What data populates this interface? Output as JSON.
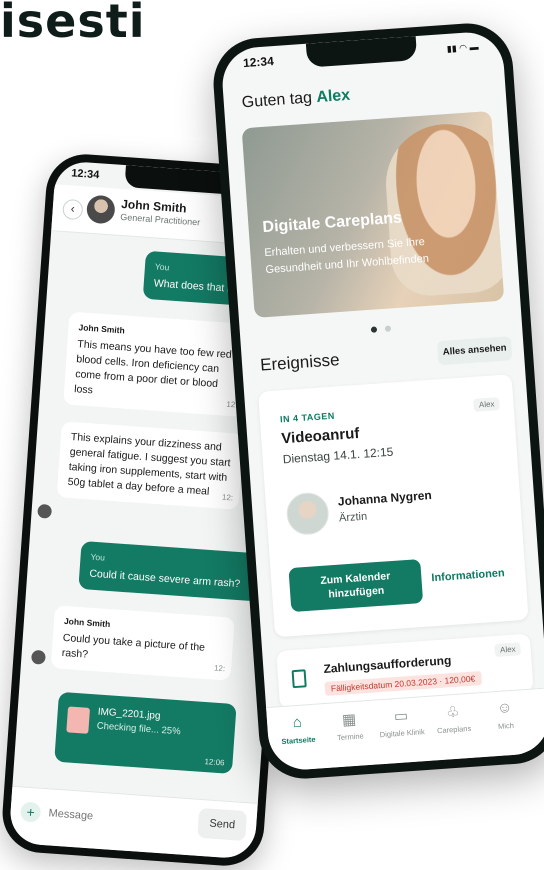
{
  "headline": "isesti",
  "chat_phone": {
    "status_time": "12:34",
    "contact": {
      "name": "John Smith",
      "role": "General Practitioner"
    },
    "messages": [
      {
        "from": "me",
        "sender": "You",
        "text": "What does that mean?"
      },
      {
        "from": "them",
        "sender": "John Smith",
        "text": "This means you have too few red blood cells. Iron deficiency can come from a poor diet or blood loss",
        "time": "12:"
      },
      {
        "from": "them",
        "text": "This explains your dizziness and general fatigue. I suggest you start taking iron supplements, start with 50g tablet a day before a meal",
        "time": "12:"
      },
      {
        "from": "me",
        "sender": "You",
        "text": "Could it cause severe arm rash?"
      },
      {
        "from": "them",
        "sender": "John Smith",
        "text": "Could you take a picture of the rash?",
        "time": "12:"
      }
    ],
    "file": {
      "name": "IMG_2201.jpg",
      "status": "Checking file... 25%",
      "time": "12:06"
    },
    "compose": {
      "placeholder": "Message",
      "send_label": "Send"
    }
  },
  "app_phone": {
    "status_time": "12:34",
    "greeting": "Guten tag",
    "user_name": "Alex",
    "banner": {
      "title": "Digitale Careplans",
      "text": "Erhalten und verbessern Sie Ihre Gesundheit und Ihr Wohlbefinden"
    },
    "events_title": "Ereignisse",
    "see_all_label": "Alles ansehen",
    "event": {
      "when": "IN 4 TAGEN",
      "tag": "Alex",
      "title": "Videoanruf",
      "date": "Dienstag 14.1. 12:15",
      "doctor_name": "Johanna Nygren",
      "doctor_role": "Ärztin",
      "primary_label": "Zum Kalender hinzufügen",
      "secondary_label": "Informationen"
    },
    "payment": {
      "title": "Zahlungsaufforderung",
      "tag": "Alex",
      "due": "Fälligkeitsdatum 20.03.2023 · 120,00€"
    },
    "tabs": [
      {
        "label": "Startseite",
        "icon": "home-icon",
        "active": true
      },
      {
        "label": "Termine",
        "icon": "calendar-icon",
        "active": false
      },
      {
        "label": "Digitale Klinik",
        "icon": "chat-icon",
        "active": false
      },
      {
        "label": "Careplans",
        "icon": "leaf-icon",
        "active": false
      },
      {
        "label": "Mich",
        "icon": "smile-icon",
        "active": false
      }
    ],
    "colors": {
      "brand": "#137a63",
      "brand_text": "#0e7a62",
      "alert": "#c0392b"
    }
  }
}
